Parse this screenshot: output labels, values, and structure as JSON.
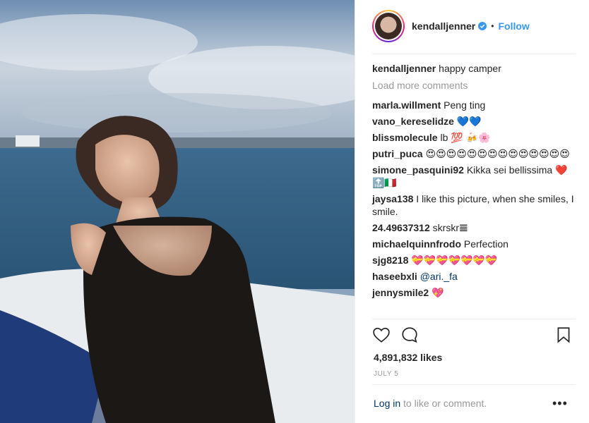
{
  "post": {
    "username": "kendalljenner",
    "follow_label": "Follow",
    "dot": "•",
    "caption_user": "kendalljenner",
    "caption_text": "happy camper",
    "load_more": "Load more comments",
    "likes": "4,891,832 likes",
    "date": "JULY 5",
    "login_link": "Log in",
    "login_text": " to like or comment.",
    "more": "•••"
  },
  "comments": [
    {
      "user": "marla.willment",
      "text": "Peng ting"
    },
    {
      "user": "vano_kereselidze",
      "text": "💙💙"
    },
    {
      "user": "blissmolecule",
      "text": "lb 💯 🍻🌸"
    },
    {
      "user": "putri_puca",
      "text": "😍😍😍😍😍😍😍😍😍😍😍😍😍😍"
    },
    {
      "user": "simone_pasquini92",
      "text": "Kikka sei bellissima ❤️🔝🇮🇹"
    },
    {
      "user": "jaysa138",
      "text": "I like this picture, when she smiles, I smile."
    },
    {
      "user": "24.49637312",
      "text": "skrskr𝌆"
    },
    {
      "user": "michaelquinnfrodo",
      "text": "Perfection"
    },
    {
      "user": "sjg8218",
      "text": "💝💝💝💝💝💝💝"
    },
    {
      "user": "haseebxli",
      "mention": "@ari._fa"
    },
    {
      "user": "jennysmile2",
      "text": "💖"
    }
  ],
  "icons": {
    "verified": "verified-badge-icon",
    "like": "heart-icon",
    "comment": "comment-bubble-icon",
    "save": "bookmark-icon"
  },
  "colors": {
    "accent": "#3897f0",
    "link": "#003569",
    "muted": "#999999"
  }
}
